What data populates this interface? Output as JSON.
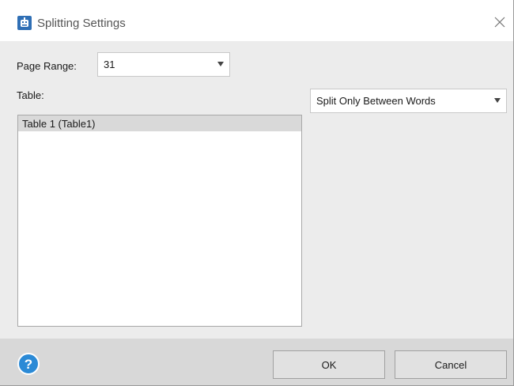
{
  "window": {
    "title": "Splitting Settings",
    "icon": "app-logo-icon",
    "close_icon": "close-icon"
  },
  "page_range": {
    "label": "Page Range:",
    "value": "31"
  },
  "table": {
    "label": "Table:",
    "items": [
      {
        "label": "Table 1 (Table1)",
        "selected": true
      }
    ]
  },
  "split_mode": {
    "value": "Split Only Between Words"
  },
  "footer": {
    "help_label": "?",
    "ok_label": "OK",
    "cancel_label": "Cancel"
  },
  "colors": {
    "accent": "#2b8ad6",
    "selection": "#d9d9d9",
    "footer_bg": "#d8d8d8",
    "dialog_bg": "#ececec"
  }
}
